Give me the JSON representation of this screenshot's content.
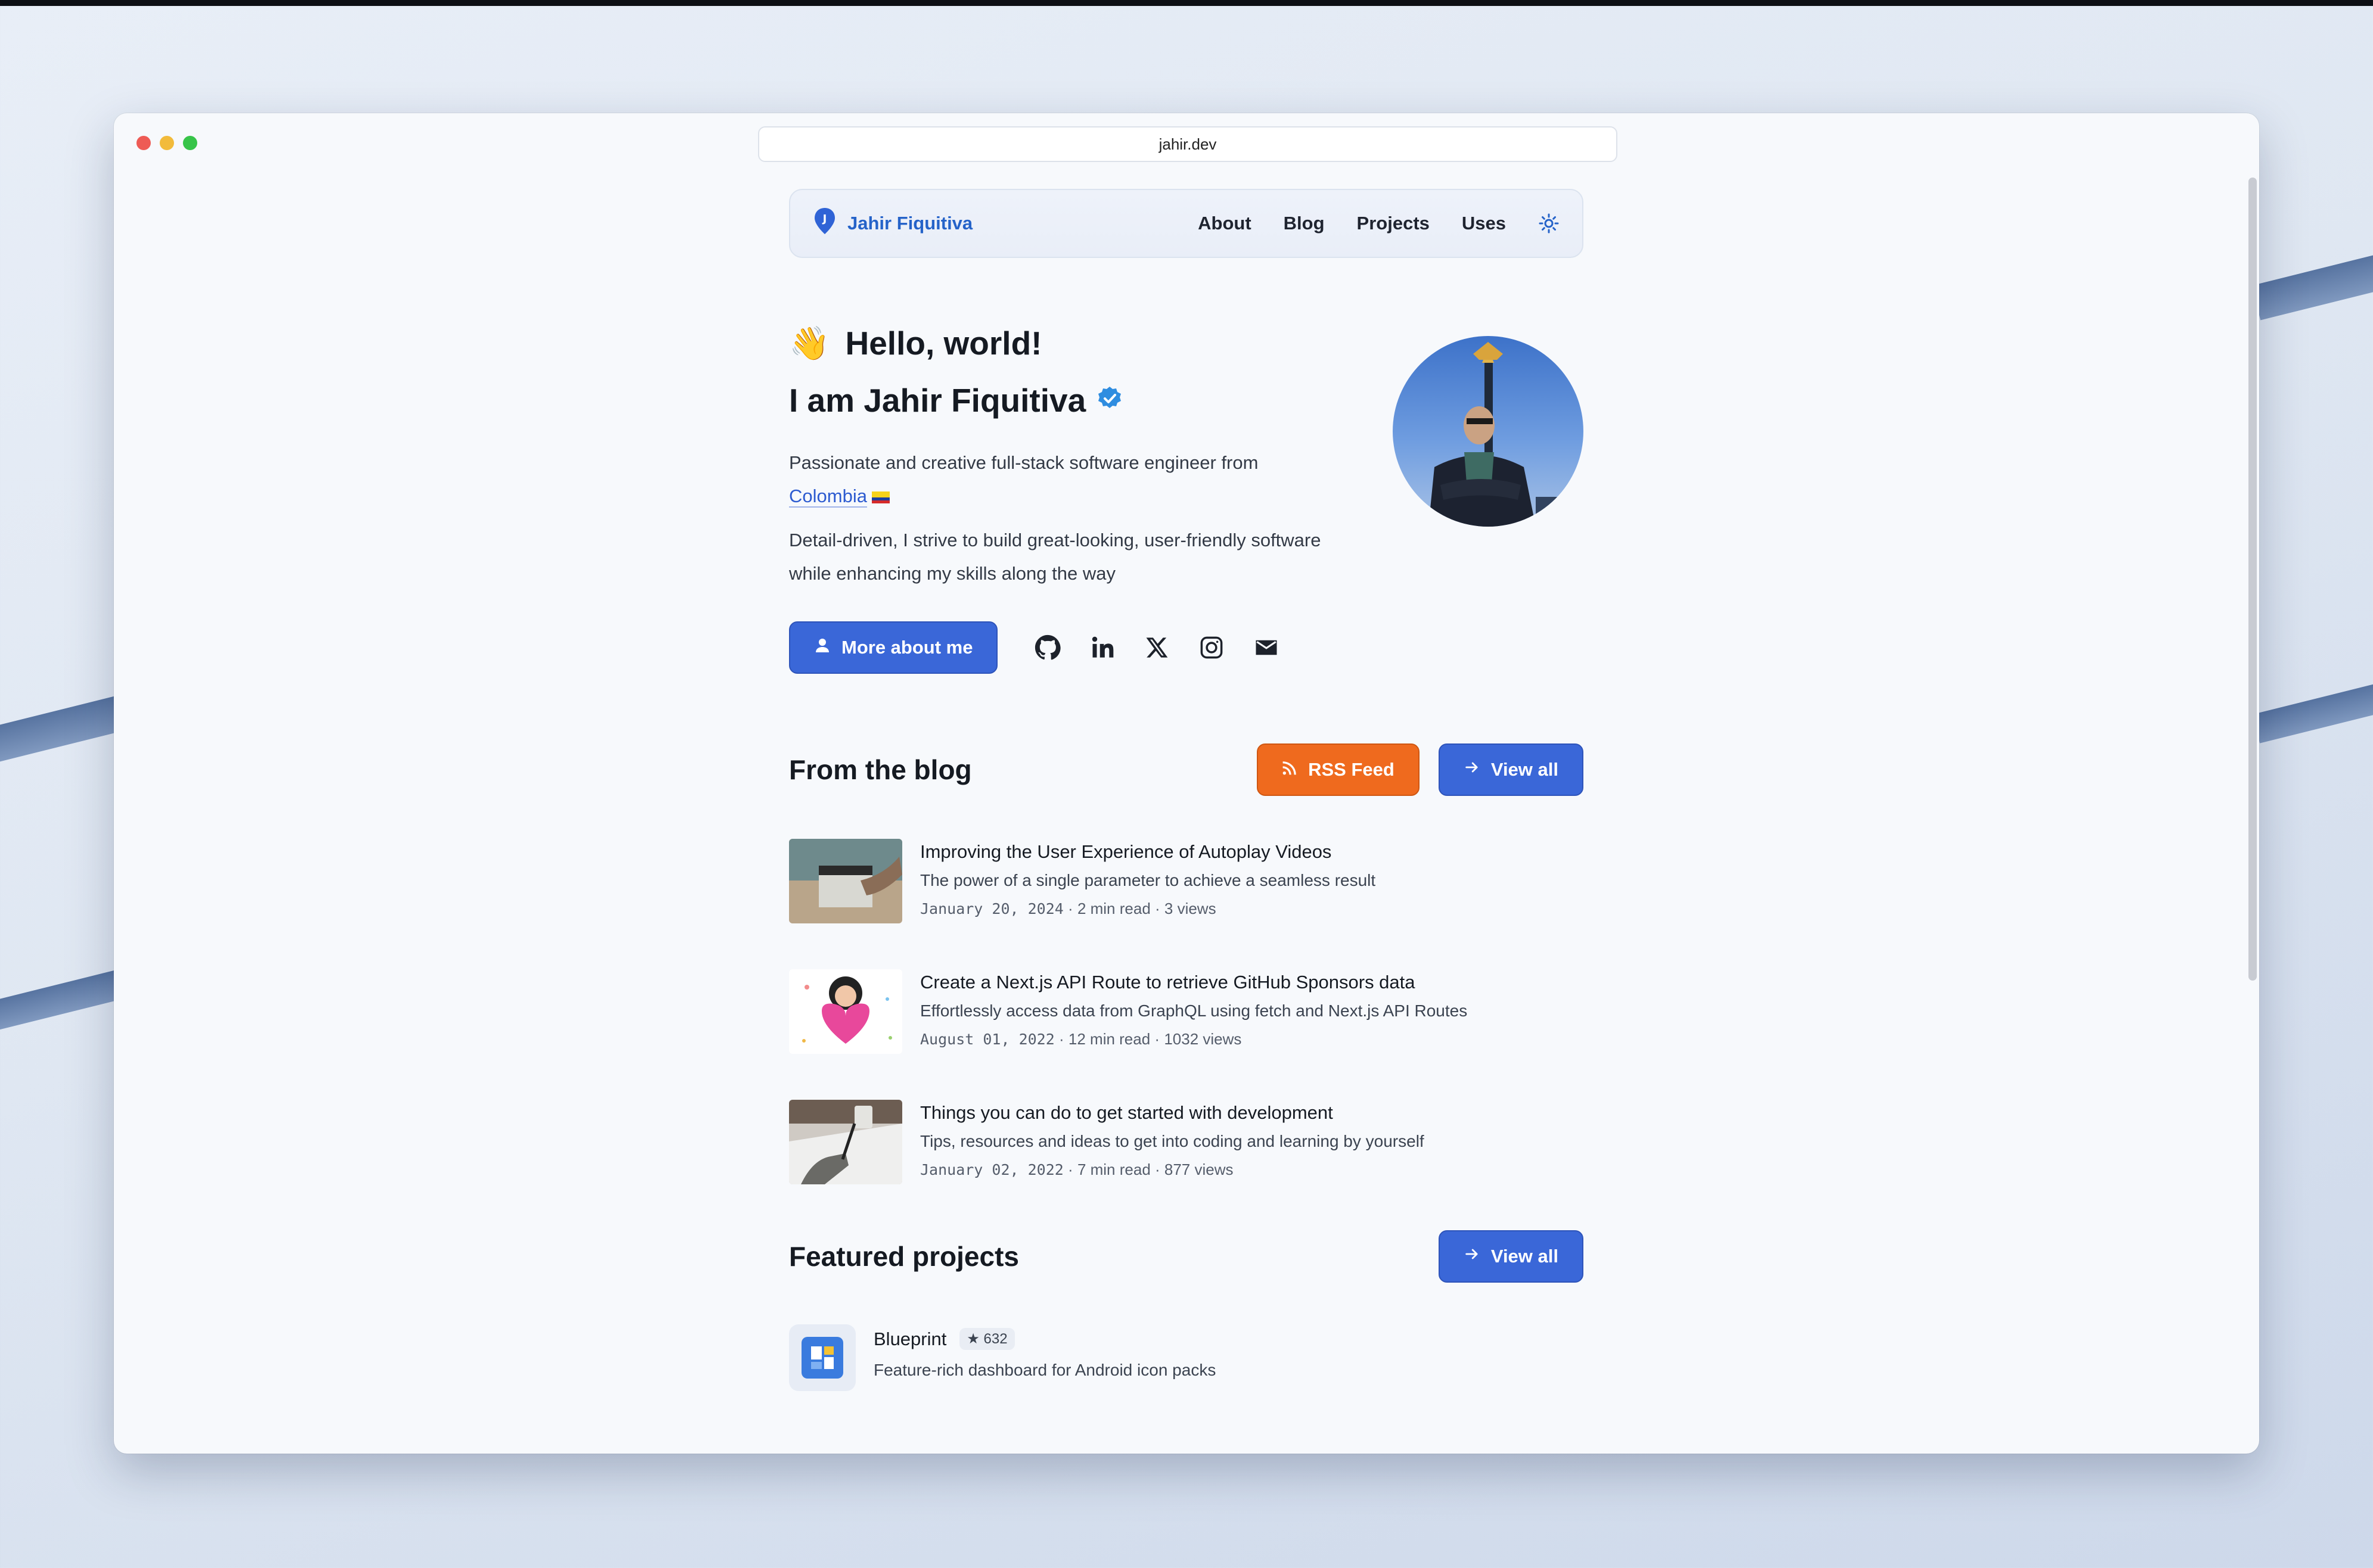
{
  "browser": {
    "url": "jahir.dev"
  },
  "nav": {
    "brand": "Jahir Fiquitiva",
    "links": [
      "About",
      "Blog",
      "Projects",
      "Uses"
    ]
  },
  "hero": {
    "greeting": "Hello, world!",
    "greeting_emoji": "👋",
    "intro": "I am Jahir Fiquitiva",
    "bio_1": "Passionate and creative full-stack software engineer from",
    "country": "Colombia",
    "bio_2": "Detail-driven, I strive to build great-looking, user-friendly software while enhancing my skills along the way",
    "more_button": "More about me",
    "social_icons": [
      "github-icon",
      "linkedin-icon",
      "x-icon",
      "instagram-icon",
      "mail-icon"
    ]
  },
  "blog": {
    "title": "From the blog",
    "rss_button": "RSS Feed",
    "view_all_button": "View all",
    "posts": [
      {
        "title": "Improving the User Experience of Autoplay Videos",
        "description": "The power of a single parameter to achieve a seamless result",
        "date": "January 20, 2024",
        "read_time": "2 min read",
        "views": "3 views"
      },
      {
        "title": "Create a Next.js API Route to retrieve GitHub Sponsors data",
        "description": "Effortlessly access data from GraphQL using fetch and Next.js API Routes",
        "date": "August 01, 2022",
        "read_time": "12 min read",
        "views": "1032 views"
      },
      {
        "title": "Things you can do to get started with development",
        "description": "Tips, resources and ideas to get into coding and learning by yourself",
        "date": "January 02, 2022",
        "read_time": "7 min read",
        "views": "877 views"
      }
    ]
  },
  "projects": {
    "title": "Featured projects",
    "view_all_button": "View all",
    "items": [
      {
        "name": "Blueprint",
        "stars": "632",
        "description": "Feature-rich dashboard for Android icon packs"
      }
    ]
  },
  "colors": {
    "accent": "#3a67d8",
    "rss": "#ef6a1e",
    "link": "#2d5bd0"
  }
}
